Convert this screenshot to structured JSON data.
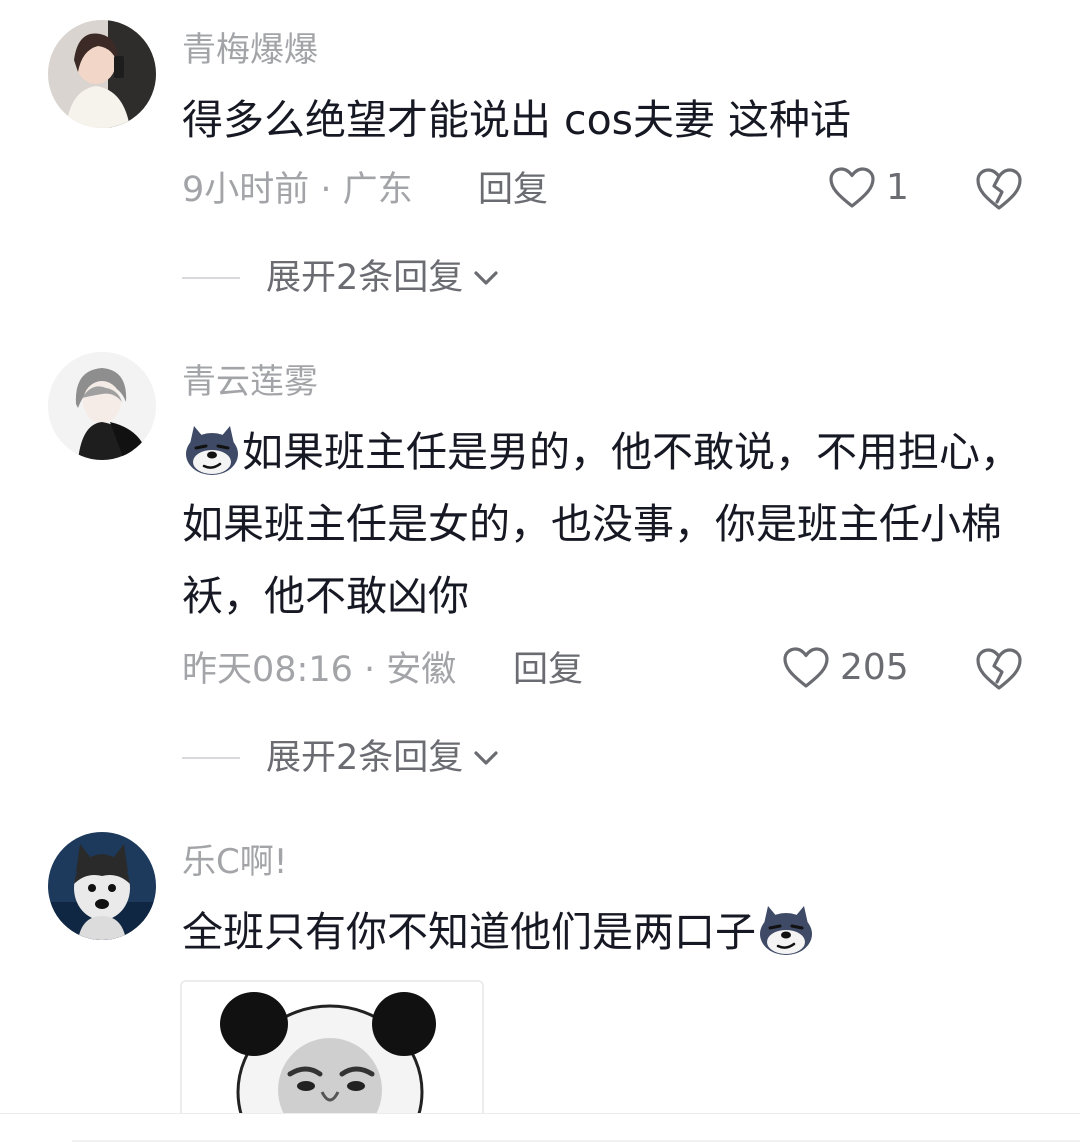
{
  "comments": [
    {
      "username": "青梅爆爆",
      "text": "得多么绝望才能说出 cos夫妻 这种话",
      "meta": "9小时前 · 广东",
      "reply_label": "回复",
      "likes": "1",
      "expand_label": "展开2条回复",
      "avatar": "woman-photo-avatar"
    },
    {
      "username": "青云莲雾",
      "text": "如果班主任是男的，他不敢说，不用担心，如果班主任是女的，也没事，你是班主任小棉袄，他不敢凶你",
      "meta": "昨天08:16 · 安徽",
      "reply_label": "回复",
      "likes": "205",
      "expand_label": "展开2条回复",
      "avatar": "anime-boy-avatar",
      "leading_emoji": "smirking-dog-emoji"
    },
    {
      "username": "乐C啊!",
      "text": "全班只有你不知道他们是两口子",
      "avatar": "husky-dog-avatar",
      "trailing_emoji": "smirking-dog-emoji",
      "attached_image": "panda-face-meme"
    }
  ],
  "icons": {
    "like": "heart-outline-icon",
    "dislike": "broken-heart-icon",
    "expand": "chevron-down-icon"
  },
  "colors": {
    "text": "#161823",
    "muted": "#a3a4a8",
    "secondary": "#6b6c72"
  }
}
